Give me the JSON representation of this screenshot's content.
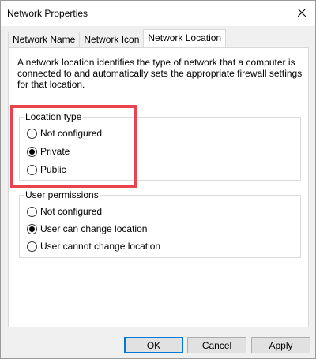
{
  "window": {
    "title": "Network Properties"
  },
  "tabs": [
    {
      "label": "Network Name"
    },
    {
      "label": "Network Icon"
    },
    {
      "label": "Network Location"
    }
  ],
  "content": {
    "description": "A network location identifies the type of network that a computer is connected to and automatically sets the appropriate firewall settings for that location."
  },
  "location_type": {
    "legend": "Location type",
    "options": [
      {
        "label": "Not configured",
        "selected": false
      },
      {
        "label": "Private",
        "selected": true
      },
      {
        "label": "Public",
        "selected": false
      }
    ]
  },
  "user_permissions": {
    "legend": "User permissions",
    "options": [
      {
        "label": "Not configured",
        "selected": false
      },
      {
        "label": "User can change location",
        "selected": true
      },
      {
        "label": "User cannot change location",
        "selected": false
      }
    ]
  },
  "buttons": {
    "ok": "OK",
    "cancel": "Cancel",
    "apply": "Apply"
  },
  "colors": {
    "highlight": "#e8434f",
    "default_button_border": "#0078d7"
  },
  "icons": {
    "close": "close-icon"
  }
}
